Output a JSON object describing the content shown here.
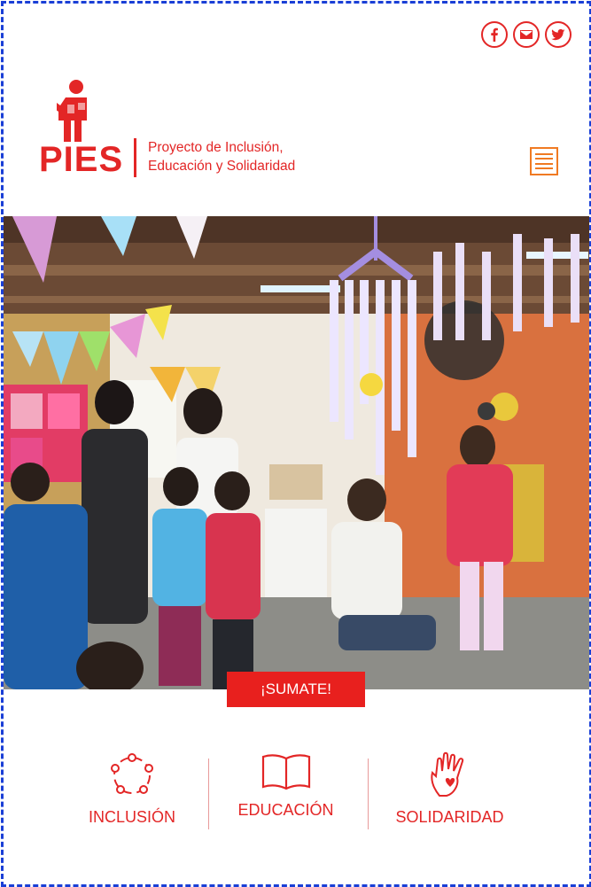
{
  "brand": {
    "name": "PIES",
    "tagline_line1": "Proyecto de Inclusión,",
    "tagline_line2": "Educación y Solidaridad",
    "color": "#e32626"
  },
  "social": [
    "facebook-icon",
    "mail-icon",
    "twitter-icon"
  ],
  "menu": {
    "icon": "hamburger-menu-icon",
    "color": "#f07a22"
  },
  "hero": {
    "cta_label": "¡SUMATE!"
  },
  "pillars": [
    {
      "label": "INCLUSIÓN",
      "icon": "circle-of-people-icon"
    },
    {
      "label": "EDUCACIÓN",
      "icon": "open-book-icon"
    },
    {
      "label": "SOLIDARIDAD",
      "icon": "hand-heart-icon"
    }
  ],
  "colors": {
    "accent": "#e32626",
    "border": "#1a3fd6",
    "cta_bg": "#e8201e"
  }
}
